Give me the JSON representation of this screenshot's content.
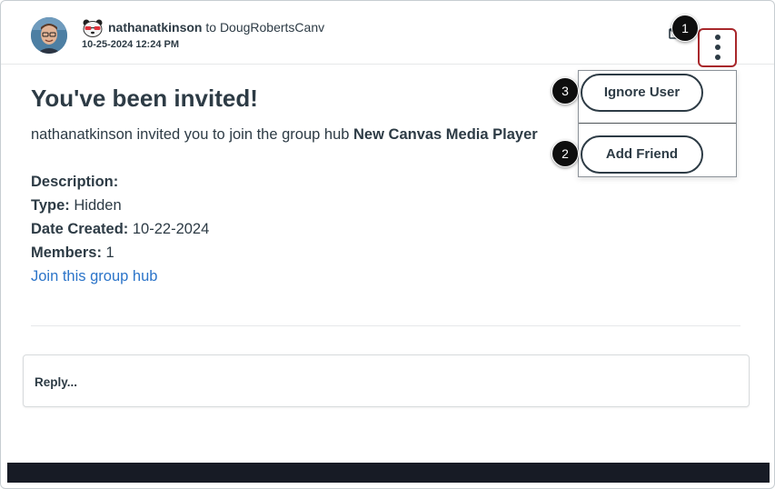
{
  "header": {
    "author": "nathanatkinson",
    "to_word": "to",
    "recipient": "DougRobertsCanv",
    "timestamp": "10-25-2024 12:24 PM",
    "avatar_icon": "user-avatar-icon",
    "rank_icon": "panda-rank-icon",
    "envelope_icon": "envelope-icon"
  },
  "message": {
    "title": "You've been invited!",
    "invite_text": "nathanatkinson invited you to join the group hub ",
    "group_name": "New Canvas Media Player"
  },
  "details": [
    {
      "label": "Description:",
      "value": ""
    },
    {
      "label": "Type:",
      "value": " Hidden"
    },
    {
      "label": "Date Created:",
      "value": " 10-22-2024"
    },
    {
      "label": "Members:",
      "value": " 1"
    }
  ],
  "join_link": "Join this group hub",
  "reply_placeholder": "Reply...",
  "menu": {
    "ignore_label": "Ignore User",
    "add_friend_label": "Add Friend"
  },
  "callouts": [
    "1",
    "2",
    "3"
  ],
  "colors": {
    "accent_red": "#a8272b",
    "link_blue": "#2b74c9",
    "text": "#2d3b45",
    "footer": "#171b25"
  }
}
